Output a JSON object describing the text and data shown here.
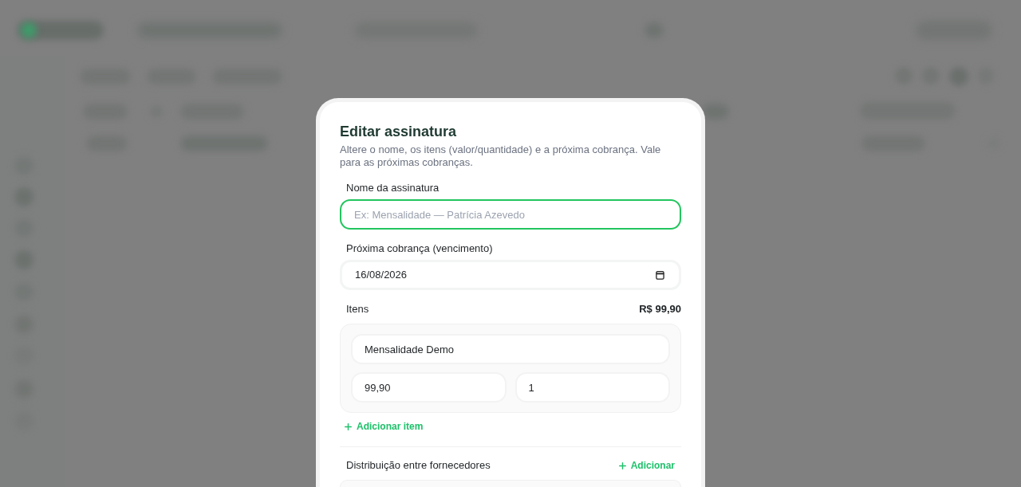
{
  "dialog": {
    "title": "Editar assinatura",
    "description": "Altere o nome, os itens (valor/quantidade) e a próxima cobrança. Vale para as próximas cobranças.",
    "fields": [
      {
        "kind": "text",
        "label": "Nome da assinatura",
        "placeholder": "Ex: Mensalidade — Patrícia Azevedo",
        "focused": true
      },
      {
        "kind": "date",
        "label": "Próxima cobrança (vencimento)",
        "value": "16/08/2026",
        "focused": false
      }
    ],
    "items_section": {
      "label": "Itens",
      "total": "R$ 99,90",
      "items": [
        {
          "name": "Mensalidade Demo",
          "price": "99,90",
          "quantity": "1"
        }
      ],
      "add_button": "Adicionar item"
    },
    "suppliers_section": {
      "label": "Distribuição entre fornecedores",
      "add_button": "Adicionar"
    }
  }
}
